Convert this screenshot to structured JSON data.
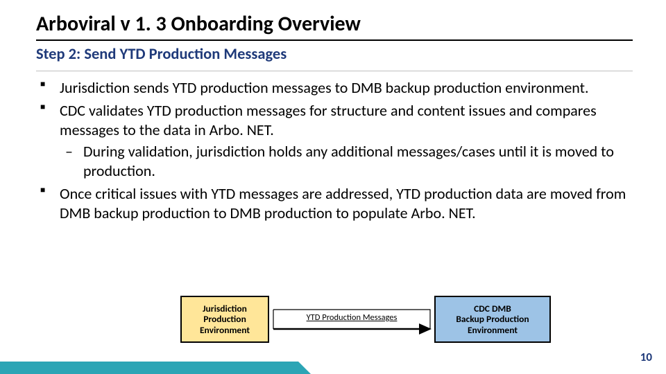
{
  "title": "Arboviral v 1. 3 Onboarding Overview",
  "subtitle": "Step 2: Send YTD Production Messages",
  "bullets": {
    "b1": "Jurisdiction sends YTD production messages to DMB backup production environment.",
    "b2": "CDC validates YTD production messages for structure and content issues and compares messages to the data in Arbo. NET.",
    "b2a": "During validation, jurisdiction holds any additional messages/cases until it is moved to production.",
    "b3": "Once critical issues with YTD messages are addressed, YTD production data are moved from DMB backup production to DMB production to populate Arbo. NET."
  },
  "diagram": {
    "left_box": "Jurisdiction\nProduction\nEnvironment",
    "arrow_label": "YTD Production Messages",
    "right_box": "CDC DMB\nBackup Production\nEnvironment"
  },
  "page_number": "10"
}
